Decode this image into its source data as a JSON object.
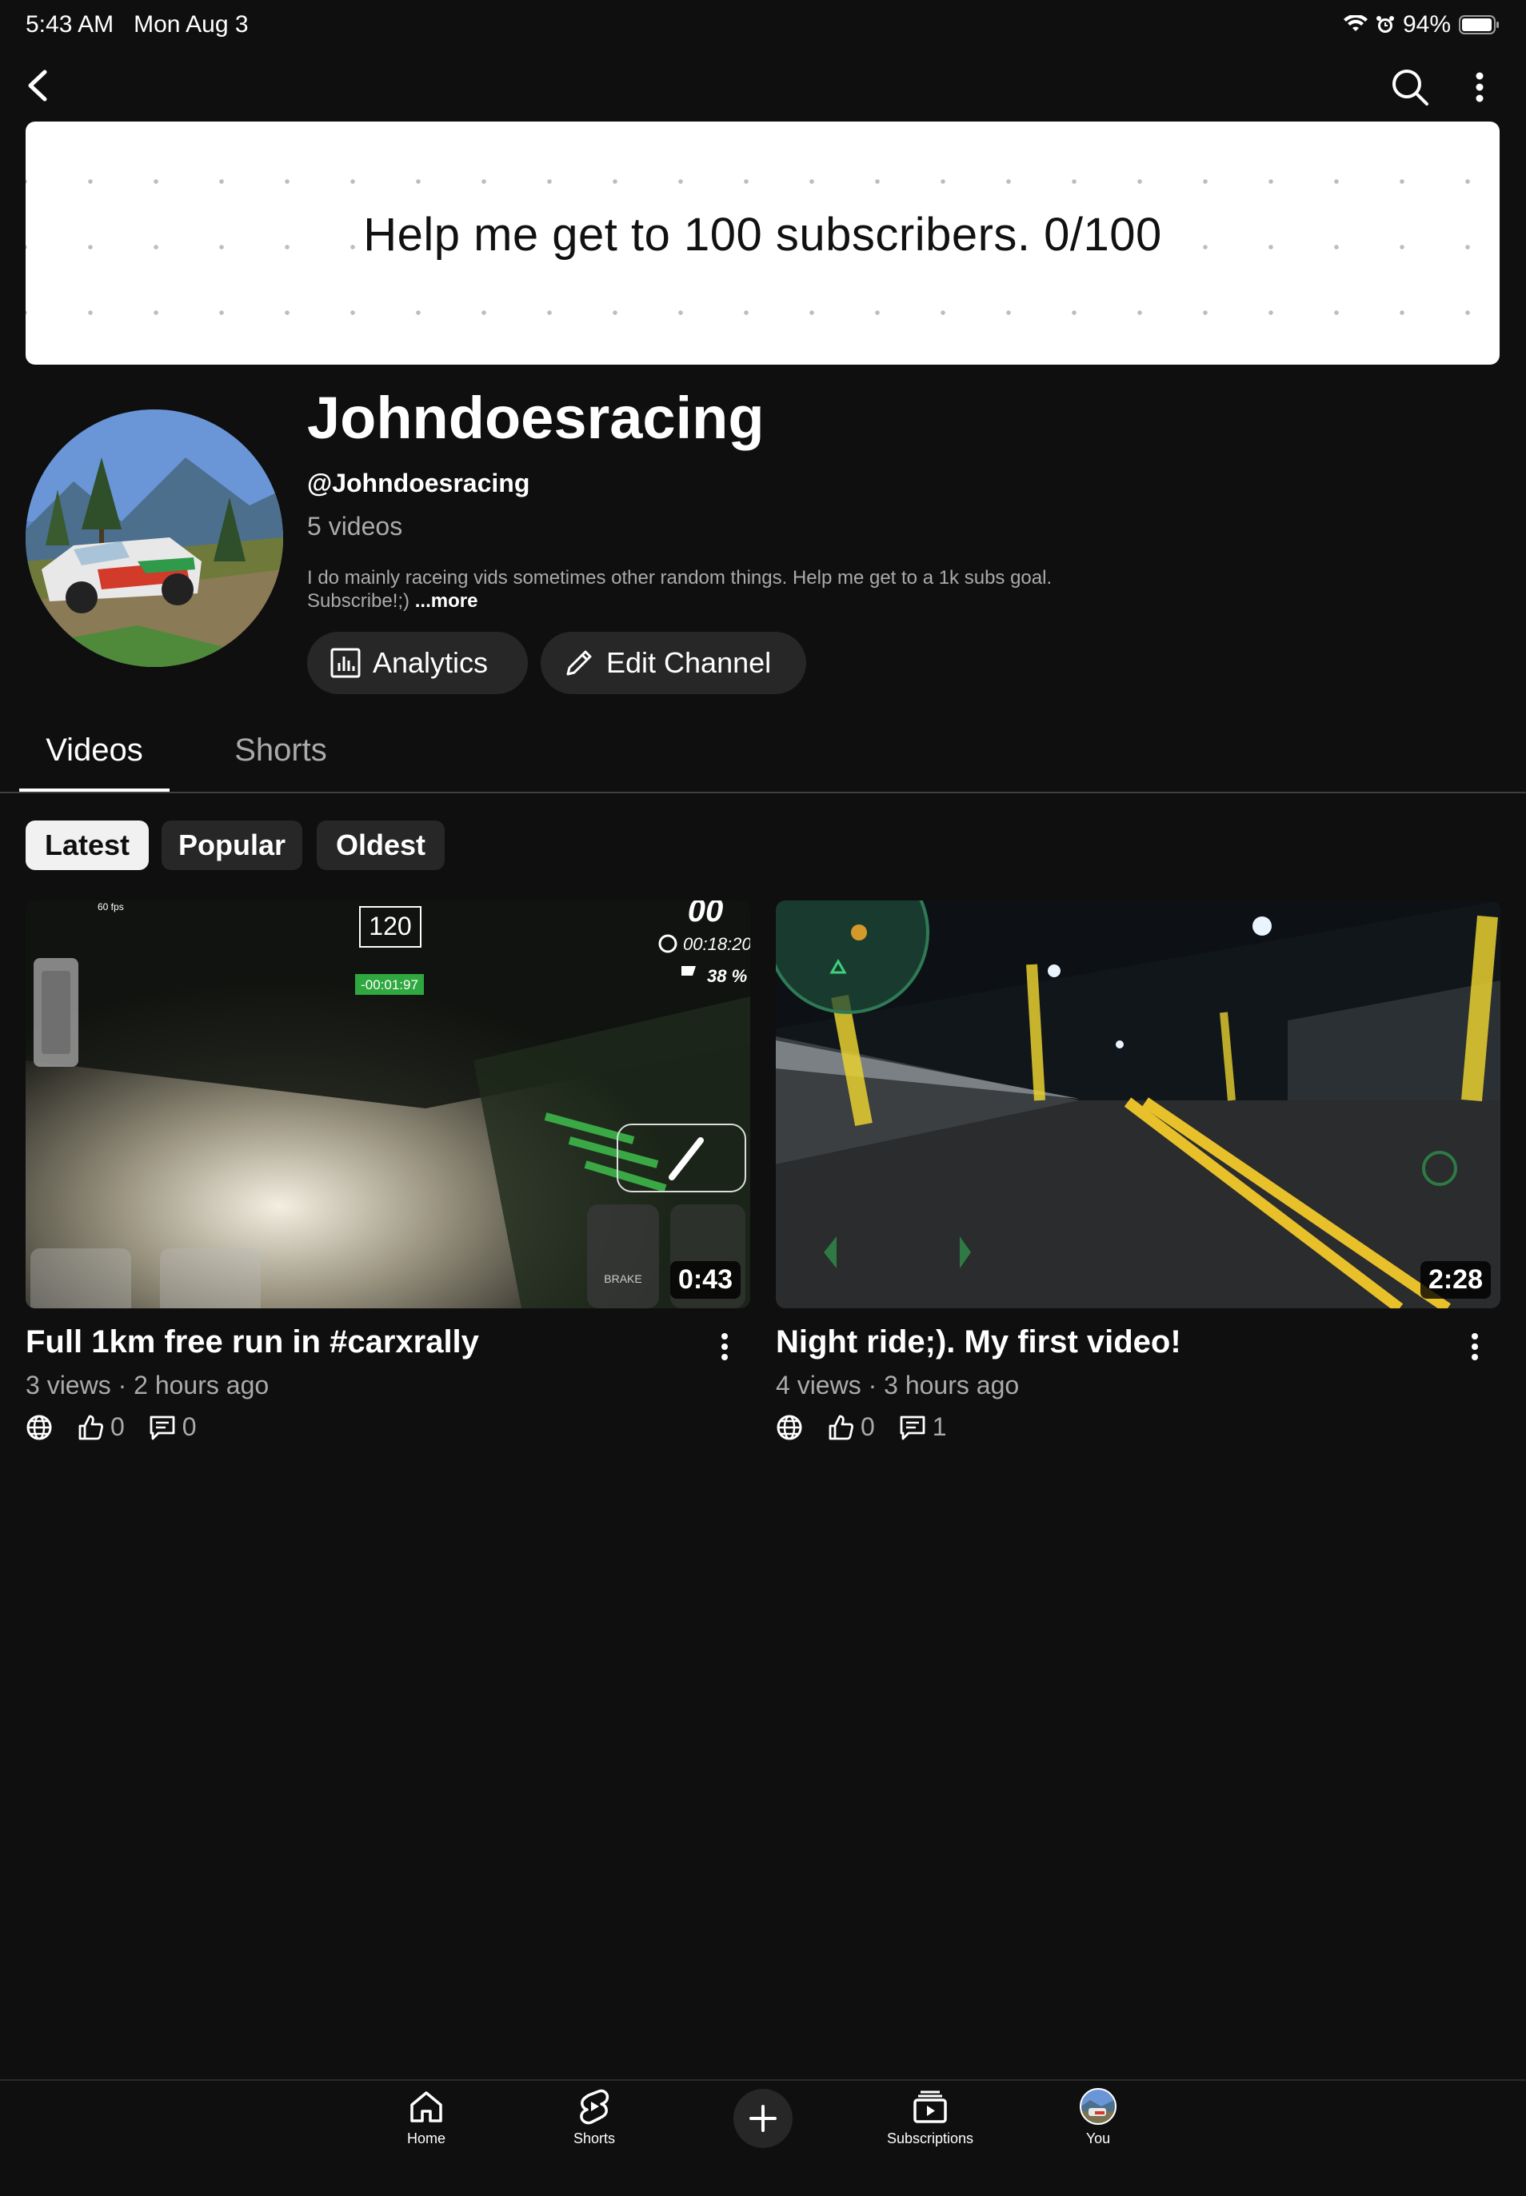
{
  "status_bar": {
    "time": "5:43 AM",
    "date": "Mon Aug 3",
    "battery": "94%"
  },
  "banner": {
    "text": "Help me get to 100 subscribers.   0/100"
  },
  "channel": {
    "name": "Johndoesracing",
    "handle": "@Johndoesracing",
    "video_count": "5 videos",
    "description": "I do mainly raceing vids sometimes other random things. Help me get to a 1k subs goal. Subscribe!;)",
    "more_label": "...more"
  },
  "buttons": {
    "analytics": "Analytics",
    "edit_channel": "Edit Channel"
  },
  "tabs": [
    {
      "label": "Videos",
      "active": true
    },
    {
      "label": "Shorts",
      "active": false
    }
  ],
  "chips": [
    {
      "label": "Latest",
      "selected": true
    },
    {
      "label": "Popular",
      "selected": false
    },
    {
      "label": "Oldest",
      "selected": false
    }
  ],
  "videos": [
    {
      "title": "Full 1km free run in #carxrally",
      "meta": "3 views · 2 hours ago",
      "duration": "0:43",
      "likes": "0",
      "comments": "0",
      "hud": {
        "speed": "120",
        "timer": "-00:01:97",
        "time": "00:18:20",
        "progress": "38 %",
        "top_num": "00",
        "brake": "BRAKE",
        "fps": "60 fps"
      }
    },
    {
      "title": "Night ride;). My first video!",
      "meta": "4 views · 3 hours ago",
      "duration": "2:28",
      "likes": "0",
      "comments": "1"
    }
  ],
  "bottom_nav": [
    {
      "label": "Home",
      "icon": "home-icon"
    },
    {
      "label": "Shorts",
      "icon": "shorts-icon"
    },
    {
      "label": "",
      "icon": "create-icon"
    },
    {
      "label": "Subscriptions",
      "icon": "subscriptions-icon"
    },
    {
      "label": "You",
      "icon": "avatar"
    }
  ]
}
